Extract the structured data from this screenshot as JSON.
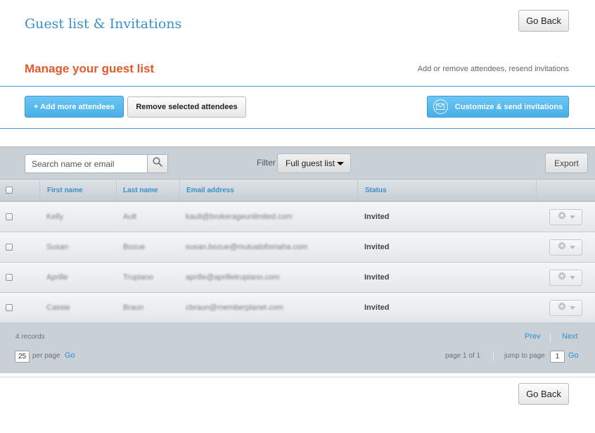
{
  "header": {
    "title": "Guest list & Invitations",
    "back_label": "Go Back"
  },
  "section": {
    "heading": "Manage your guest list",
    "subtitle": "Add or remove attendees, resend invitations"
  },
  "actions": {
    "add_label": "+ Add more attendees",
    "remove_label": "Remove selected attendees",
    "send_label": "Customize & send invitations"
  },
  "toolbar": {
    "search_placeholder": "Search name or email",
    "filter_label": "Filter",
    "filter_value": "Full guest list",
    "export_label": "Export"
  },
  "table": {
    "columns": [
      "First name",
      "Last name",
      "Email address",
      "Status"
    ],
    "rows": [
      {
        "first": "Kelly",
        "last": "Ault",
        "email": "kault@brokerageunlimited.com",
        "status": "Invited"
      },
      {
        "first": "Susan",
        "last": "Bozue",
        "email": "susan.bozue@mutualofomaha.com",
        "status": "Invited"
      },
      {
        "first": "Aprille",
        "last": "Trupiano",
        "email": "aprille@aprilletrupiano.com",
        "status": "Invited"
      },
      {
        "first": "Cassie",
        "last": "Braun",
        "email": "cbraun@memberplanet.com",
        "status": "Invited"
      }
    ]
  },
  "pagination": {
    "records": "4 records",
    "per_page_value": "25",
    "per_page_label": "per page",
    "go_label": "Go",
    "prev_label": "Prev",
    "next_label": "Next",
    "page_info": "page 1 of 1",
    "jump_label": "jump to page",
    "jump_value": "1"
  },
  "footer": {
    "back_label": "Go Back"
  },
  "colors": {
    "title_blue": "#3a8fc8",
    "heading_orange": "#e05a2b",
    "button_blue": "#48b0e8",
    "link_blue": "#2e8fd1"
  }
}
